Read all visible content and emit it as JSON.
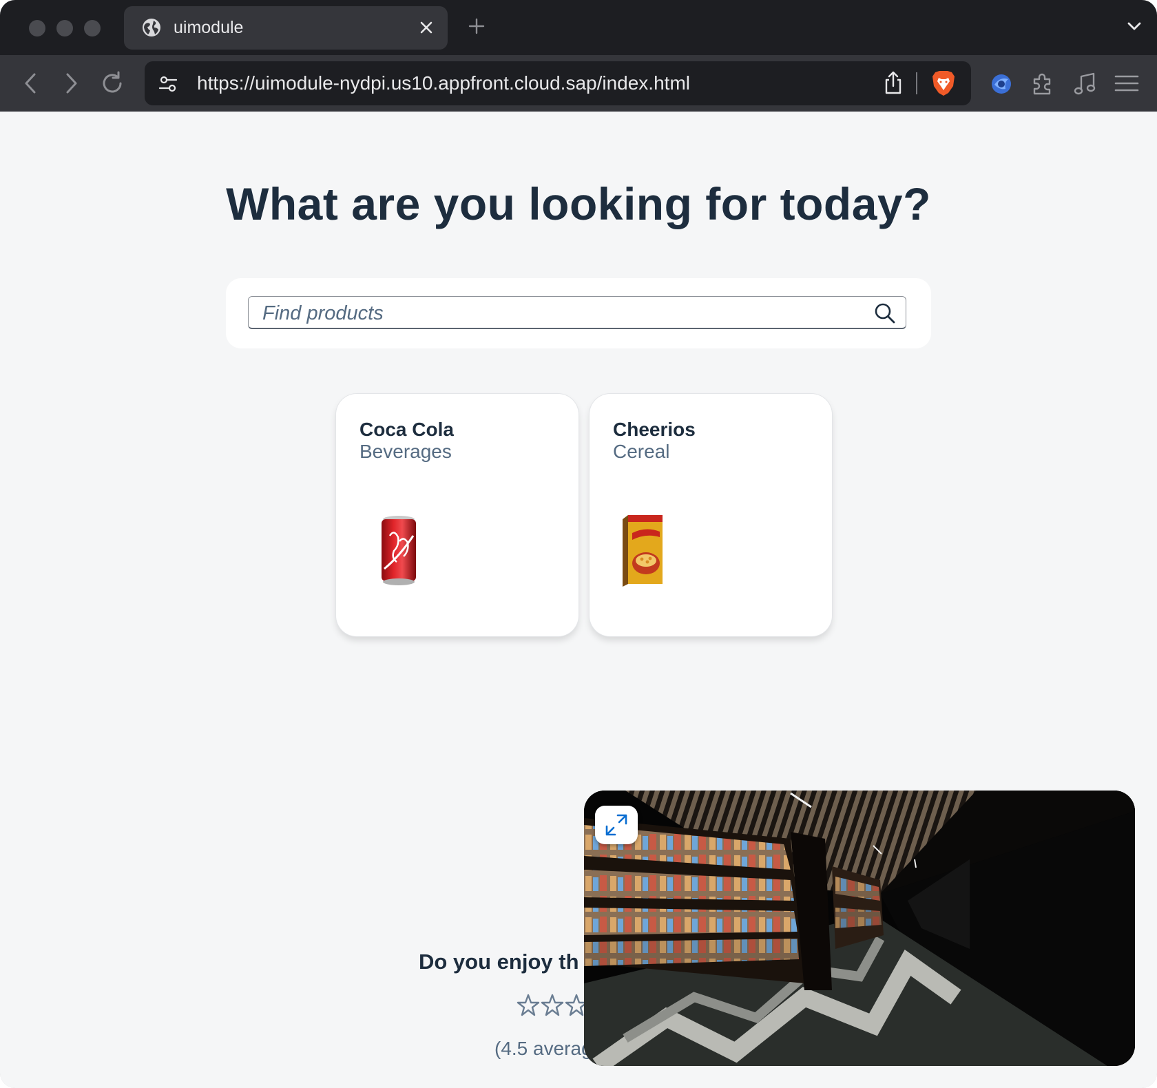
{
  "browser": {
    "tab_title": "uimodule",
    "url": "https://uimodule-nydpi.us10.appfront.cloud.sap/index.html"
  },
  "page": {
    "headline": "What are you looking for today?",
    "search": {
      "placeholder": "Find products",
      "value": ""
    },
    "products": [
      {
        "name": "Coca Cola",
        "category": "Beverages",
        "icon": "soda-can-image"
      },
      {
        "name": "Cheerios",
        "category": "Cereal",
        "icon": "cereal-box-image"
      }
    ],
    "rating": {
      "question_visible": "Do you enjoy th",
      "average_visible": "(4.5 averag",
      "stars_visible": 3
    }
  },
  "viewer": {
    "icon": "expand-icon"
  },
  "colors": {
    "heading": "#1d2d3e",
    "subtle_text": "#556b82",
    "page_bg": "#f5f6f7",
    "accent": "#0a6ed1"
  }
}
